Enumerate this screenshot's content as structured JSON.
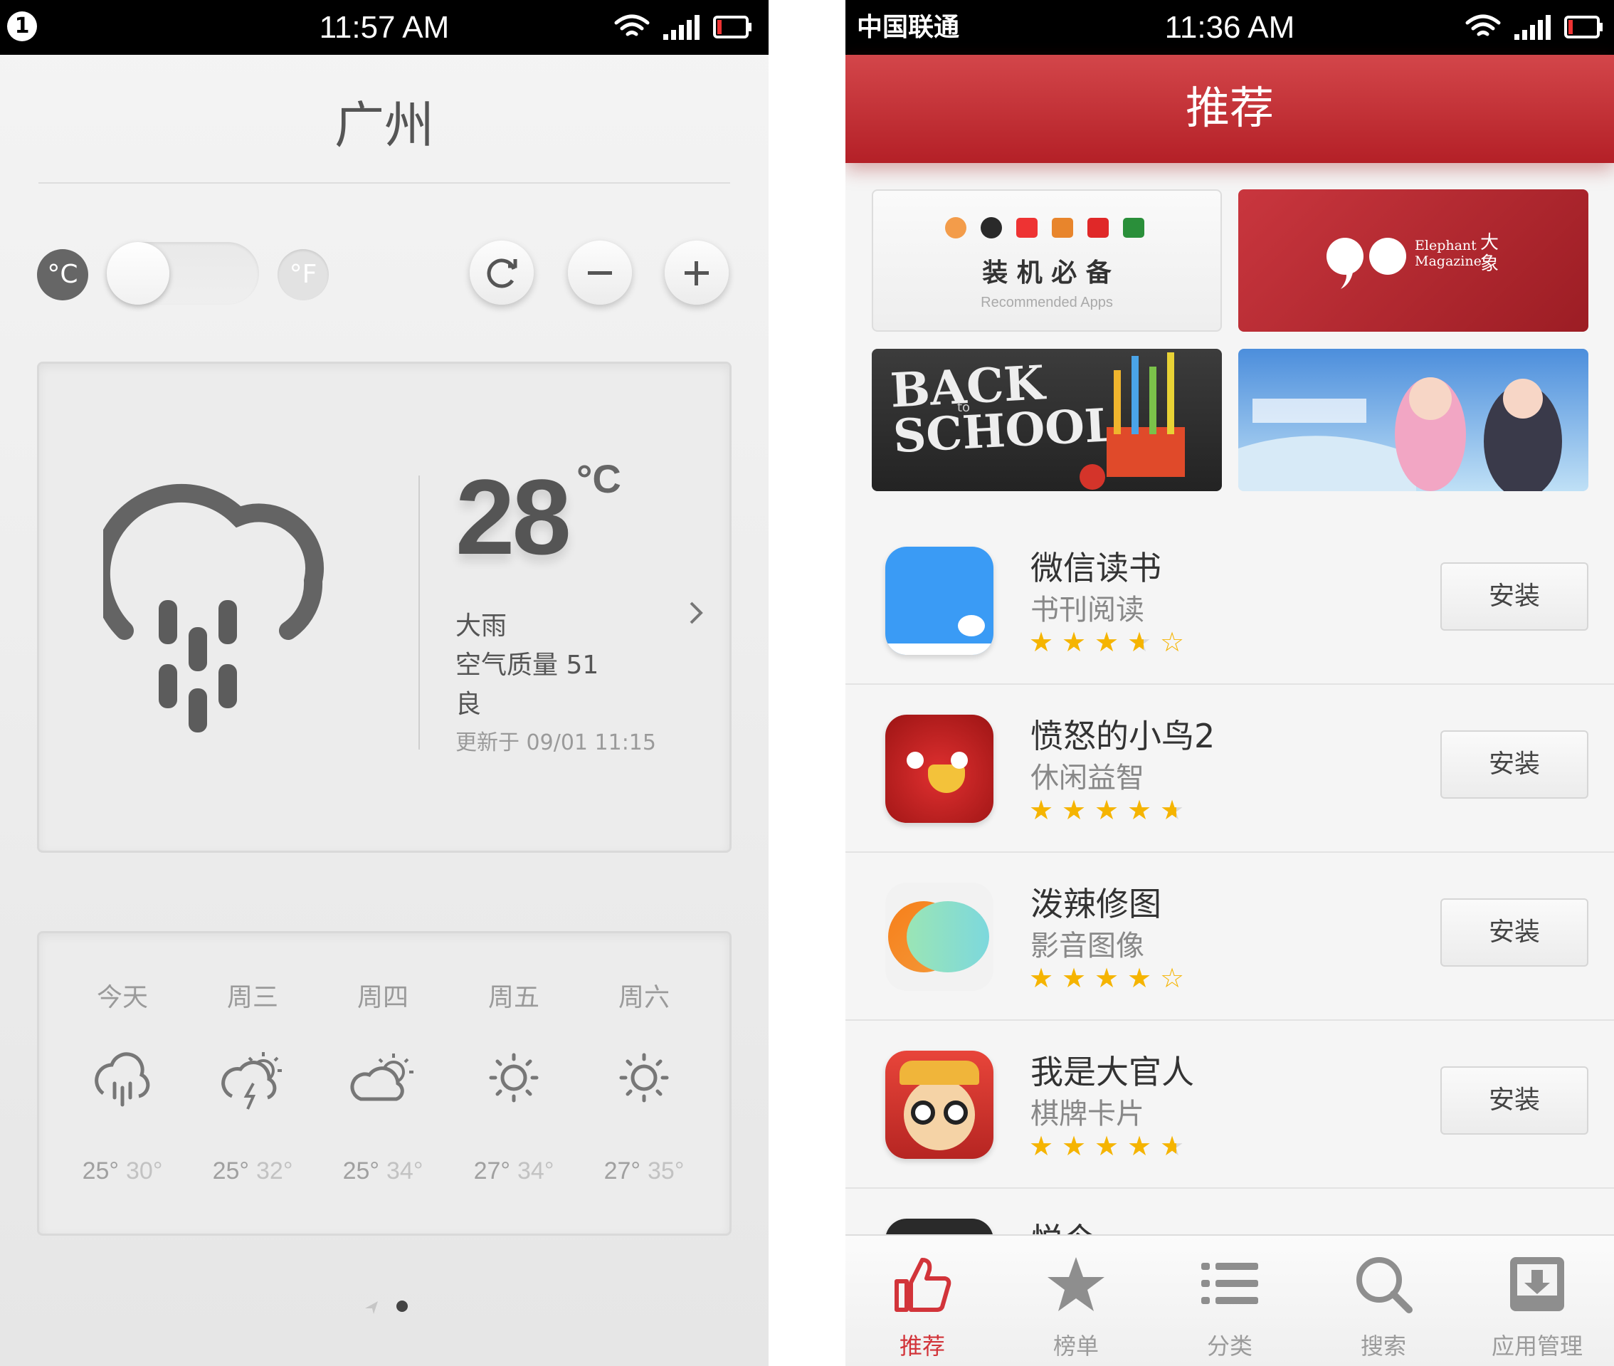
{
  "left": {
    "status": {
      "notification_count": "1",
      "time": "11:57 AM"
    },
    "city": "广州",
    "unit_c": "°C",
    "unit_f": "°F",
    "current": {
      "temp": "28",
      "unit": "°C",
      "condition": "大雨",
      "aqi": "空气质量 51",
      "aqi_level": "良",
      "updated": "更新于 09/01 11:15"
    },
    "forecast": [
      {
        "day": "今天",
        "lo": "25°",
        "hi": "30°",
        "icon": "rain-icon"
      },
      {
        "day": "周三",
        "lo": "25°",
        "hi": "32°",
        "icon": "thunder-sun-icon"
      },
      {
        "day": "周四",
        "lo": "25°",
        "hi": "34°",
        "icon": "partly-cloudy-icon"
      },
      {
        "day": "周五",
        "lo": "27°",
        "hi": "34°",
        "icon": "sun-icon"
      },
      {
        "day": "周六",
        "lo": "27°",
        "hi": "35°",
        "icon": "sun-icon"
      }
    ],
    "page_indicator": {
      "pages": 2,
      "active": 2
    }
  },
  "right": {
    "status": {
      "carrier": "中国联通",
      "time": "11:36 AM"
    },
    "title": "推荐",
    "banners": {
      "essentials_title": "装 机 必 备",
      "essentials_sub": "Recommended Apps",
      "magazine_en1": "Elephant",
      "magazine_en2": "Magazine",
      "magazine_cn": "大象",
      "back_to_school_1": "BACK",
      "back_to_school_to": "to",
      "back_to_school_2": "SCHOOL"
    },
    "apps": [
      {
        "name": "微信读书",
        "category": "书刊阅读",
        "rating": 3.5,
        "action": "安装",
        "icon": "wechat-read-icon"
      },
      {
        "name": "愤怒的小鸟2",
        "category": "休闲益智",
        "rating": 4.5,
        "action": "安装",
        "icon": "angry-birds-icon"
      },
      {
        "name": "泼辣修图",
        "category": "影音图像",
        "rating": 4,
        "action": "安装",
        "icon": "polarr-icon"
      },
      {
        "name": "我是大官人",
        "category": "棋牌卡片",
        "rating": 4.5,
        "action": "安装",
        "icon": "game-character-icon"
      },
      {
        "name": "悦今",
        "category": "",
        "rating": 0,
        "action": "",
        "icon": "app-icon"
      }
    ],
    "tabs": [
      {
        "label": "推荐",
        "active": true,
        "icon": "thumbs-up-icon"
      },
      {
        "label": "榜单",
        "active": false,
        "icon": "star-icon"
      },
      {
        "label": "分类",
        "active": false,
        "icon": "list-icon"
      },
      {
        "label": "搜索",
        "active": false,
        "icon": "search-icon"
      },
      {
        "label": "应用管理",
        "active": false,
        "icon": "download-box-icon"
      }
    ],
    "colors": {
      "brand_red": "#c0282e",
      "star_yellow": "#f5b400"
    }
  }
}
